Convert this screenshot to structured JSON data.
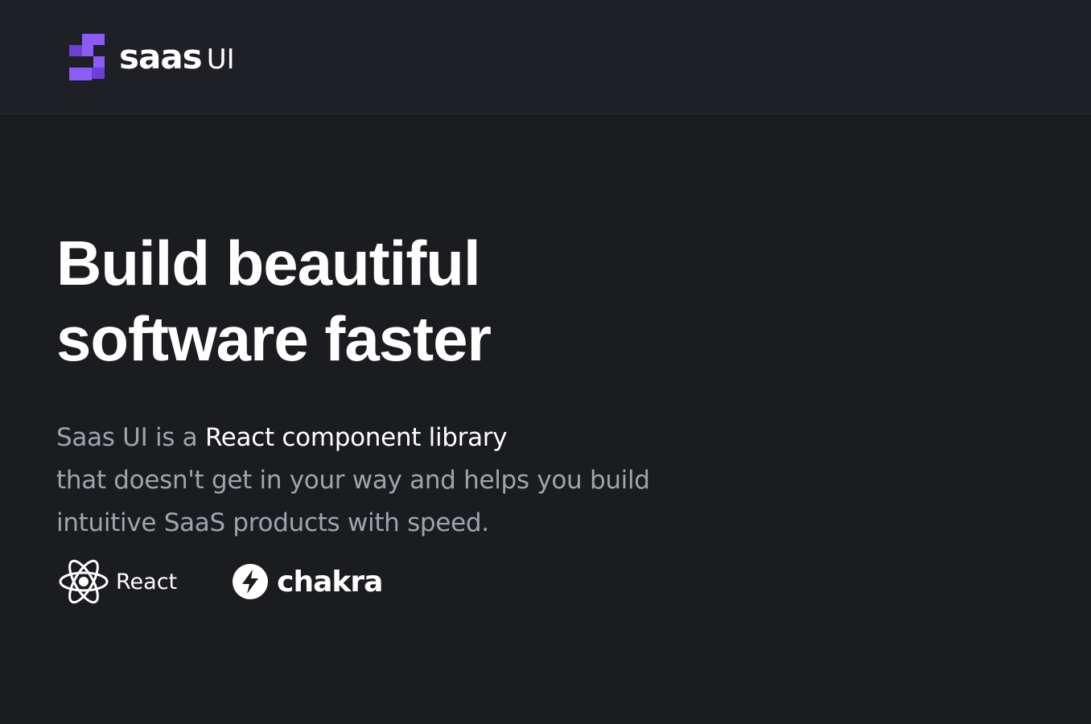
{
  "header": {
    "logo": {
      "word": "saas",
      "suffix": "UI",
      "accent_color": "#8b5cf6",
      "icon": "saas-ui-logo-icon"
    }
  },
  "hero": {
    "headline_line1": "Build beautiful",
    "headline_line2": "software faster",
    "subtext": {
      "part1": "Saas UI is a ",
      "highlight": "React component library",
      "part2": "that doesn't get in your way and helps you build intuitive SaaS products with speed."
    }
  },
  "tech_logos": [
    {
      "label": "React",
      "icon": "react-icon"
    },
    {
      "label": "chakra",
      "icon": "chakra-bolt-icon"
    }
  ],
  "colors": {
    "background": "#1a1c20",
    "header_background": "#1e2026",
    "text_primary": "#ffffff",
    "text_muted": "#a0a4ac"
  }
}
